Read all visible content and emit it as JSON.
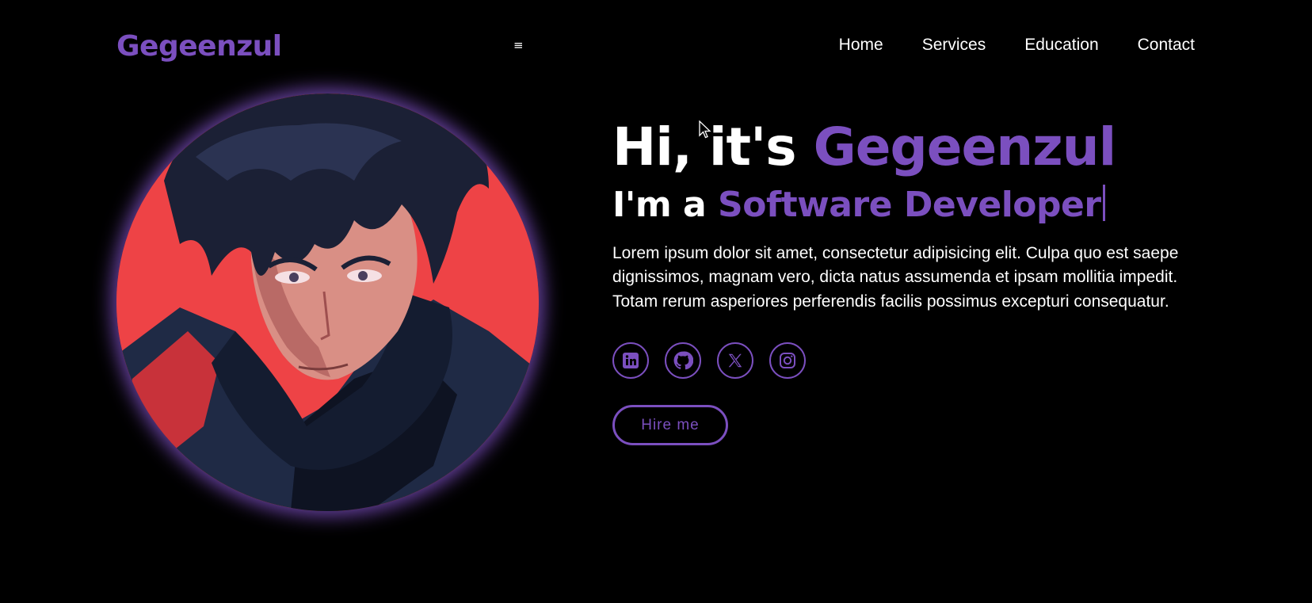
{
  "header": {
    "logo": "Gegeenzul",
    "menu_icon": "hamburger-icon",
    "menu_glyph": "≡",
    "nav": [
      {
        "label": "Home"
      },
      {
        "label": "Services"
      },
      {
        "label": "Education"
      },
      {
        "label": "Contact"
      }
    ]
  },
  "hero": {
    "greeting_prefix": "Hi, it's",
    "name": "Gegeenzul",
    "role_prefix": "I'm a",
    "role": "Software Developer",
    "description": "Lorem ipsum dolor sit amet, consectetur adipisicing elit. Culpa quo est saepe dignissimos, magnam vero, dicta natus assumenda et ipsam mollitia impedit. Totam rerum asperiores perferendis facilis possimus excepturi consequatur.",
    "socials": [
      {
        "icon": "linkedin-icon"
      },
      {
        "icon": "github-icon"
      },
      {
        "icon": "x-twitter-icon"
      },
      {
        "icon": "instagram-icon"
      }
    ],
    "cta_label": "Hire me"
  },
  "portrait": {
    "icon": "anime-portrait-image"
  },
  "colors": {
    "background": "#000000",
    "accent": "#7b4fbf",
    "text": "#ffffff",
    "portrait_bg": "#ef4448"
  }
}
